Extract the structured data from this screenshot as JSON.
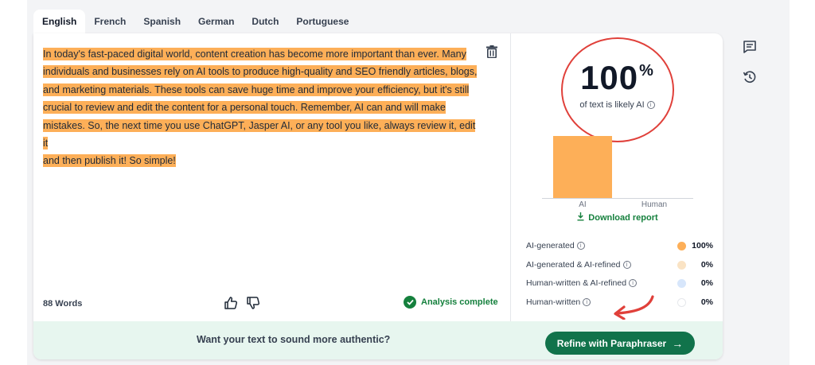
{
  "tabs": [
    "English",
    "French",
    "Spanish",
    "German",
    "Dutch",
    "Portuguese"
  ],
  "editor": {
    "text_lines": [
      "In today's fast-paced digital world, content creation has become more important than ever. Many",
      "individuals and businesses rely on AI tools to produce high-quality and SEO friendly articles, blogs,",
      "and marketing materials. These tools can save huge time and improve your efficiency, but it's still",
      "crucial to review and edit the content for a personal touch. Remember, AI can and will make",
      "mistakes. So, the next time you use ChatGPT, Jasper AI, or any tool you like, always review it, edit it",
      "and then publish it! So simple!"
    ],
    "word_count": "88 Words",
    "status": "Analysis complete",
    "highlight_color": "#fdaf58"
  },
  "results": {
    "score_value": "100",
    "score_unit": "%",
    "score_label": "of text is likely AI",
    "download_label": "Download report",
    "chart_data": {
      "type": "bar",
      "categories": [
        "AI",
        "Human"
      ],
      "values": [
        100,
        0
      ],
      "ylim": [
        0,
        100
      ],
      "bar_color": "#fdaf58"
    },
    "legend": [
      {
        "label": "AI-generated",
        "value": "100%",
        "color": "#fdaf58"
      },
      {
        "label": "AI-generated & AI-refined",
        "value": "0%",
        "color": "#fae3c4"
      },
      {
        "label": "Human-written & AI-refined",
        "value": "0%",
        "color": "#d7e6fb"
      },
      {
        "label": "Human-written",
        "value": "0%",
        "color": "#ffffff"
      }
    ]
  },
  "banner": {
    "prompt": "Want your text to sound more authentic?",
    "button_label": "Refine with Paraphraser"
  },
  "colors": {
    "accent_green": "#11734b",
    "annotation_red": "#e0403a"
  }
}
